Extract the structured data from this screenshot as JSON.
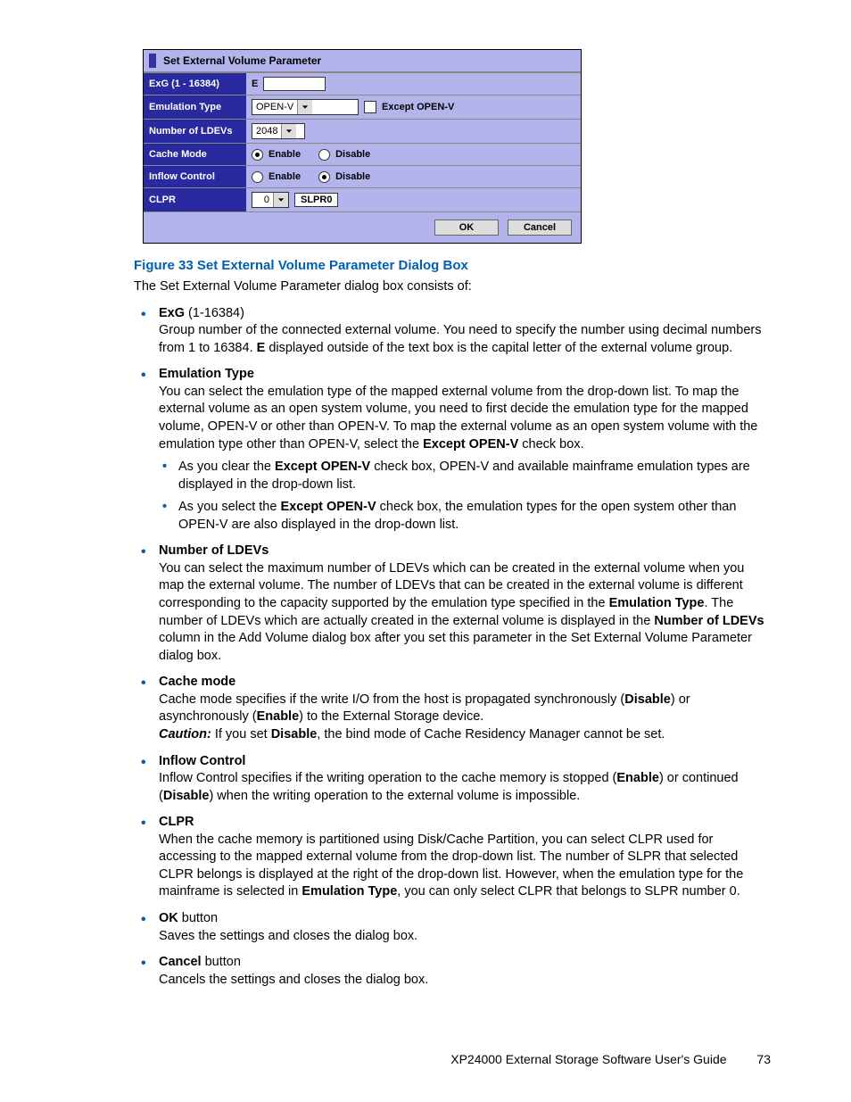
{
  "dialog": {
    "title": "Set External Volume Parameter",
    "rows": {
      "exg": {
        "label": "ExG (1 - 16384)",
        "prefix": "E",
        "value": ""
      },
      "emu": {
        "label": "Emulation Type",
        "value": "OPEN-V",
        "checkbox_label": "Except OPEN-V"
      },
      "ldev": {
        "label": "Number of LDEVs",
        "value": "2048"
      },
      "cache": {
        "label": "Cache Mode",
        "opt1": "Enable",
        "opt2": "Disable"
      },
      "inflow": {
        "label": "Inflow Control",
        "opt1": "Enable",
        "opt2": "Disable"
      },
      "clpr": {
        "label": "CLPR",
        "value": "0",
        "slpr": "SLPR0"
      }
    },
    "ok": "OK",
    "cancel": "Cancel"
  },
  "figure_caption": "Figure 33 Set External Volume Parameter Dialog Box",
  "intro": "The Set External Volume Parameter dialog box consists of:",
  "items": {
    "exg": {
      "title": "ExG",
      "range": " (1-16384)",
      "body1": "Group number of the connected external volume. You need to specify the number using decimal numbers from 1 to 16384. ",
      "b1": "E",
      "body2": " displayed outside of the text box is the capital letter of the external volume group."
    },
    "emu": {
      "title": "Emulation Type",
      "body": "You can select the emulation type of the mapped external volume from the drop-down list. To map the external volume as an open system volume, you need to first decide the emulation type for the mapped volume, OPEN-V or other than OPEN-V. To map the external volume as an open system volume with the emulation type other than OPEN-V, select the ",
      "b1": "Except OPEN-V",
      "body2": " check box.",
      "sub1a": "As you clear the ",
      "sub1b": "Except OPEN-V",
      "sub1c": " check box, OPEN-V and available mainframe emulation types are displayed in the drop-down list.",
      "sub2a": "As you select the ",
      "sub2b": "Except OPEN-V",
      "sub2c": " check box, the emulation types for the open system other than OPEN-V are also displayed in the drop-down list."
    },
    "ldev": {
      "title": "Number of LDEVs",
      "body1": "You can select the maximum number of LDEVs which can be created in the external volume when you map the external volume. The number of LDEVs that can be created in the external volume is different corresponding to the capacity supported by the emulation type specified in the ",
      "b1": "Emulation Type",
      "body2": ". The number of LDEVs which are actually created in the external volume is displayed in the ",
      "b2": "Number of LDEVs",
      "body3": " column in the Add Volume dialog box after you set this parameter in the Set External Volume Parameter dialog box."
    },
    "cache": {
      "title": "Cache mode",
      "body1": "Cache mode specifies if the write I/O from the host is propagated synchronously (",
      "b1": "Disable",
      "body2": ") or asynchronously (",
      "b2": "Enable",
      "body3": ") to the External Storage device.",
      "caution_label": "Caution:",
      "caution1": " If you set ",
      "cb": "Disable",
      "caution2": ", the bind mode of Cache Residency Manager cannot be set."
    },
    "inflow": {
      "title": "Inflow Control",
      "body1": "Inflow Control specifies if the writing operation to the cache memory is stopped (",
      "b1": "Enable",
      "body2": ") or continued (",
      "b2": "Disable",
      "body3": ") when the writing operation to the external volume is impossible."
    },
    "clpr": {
      "title": "CLPR",
      "body1": "When the cache memory is partitioned using Disk/Cache Partition, you can select CLPR used for accessing to the mapped external volume from the drop-down list. The number of SLPR that selected CLPR belongs is displayed at the right of the drop-down list. However, when the emulation type for the mainframe is selected in ",
      "b1": "Emulation Type",
      "body2": ", you can only select CLPR that belongs to SLPR number 0."
    },
    "okbtn": {
      "title": "OK",
      "suffix": " button",
      "body": "Saves the settings and closes the dialog box."
    },
    "cancelbtn": {
      "title": "Cancel",
      "suffix": " button",
      "body": "Cancels the settings and closes the dialog box."
    }
  },
  "footer": {
    "text": "XP24000 External Storage Software User's Guide",
    "page": "73"
  }
}
